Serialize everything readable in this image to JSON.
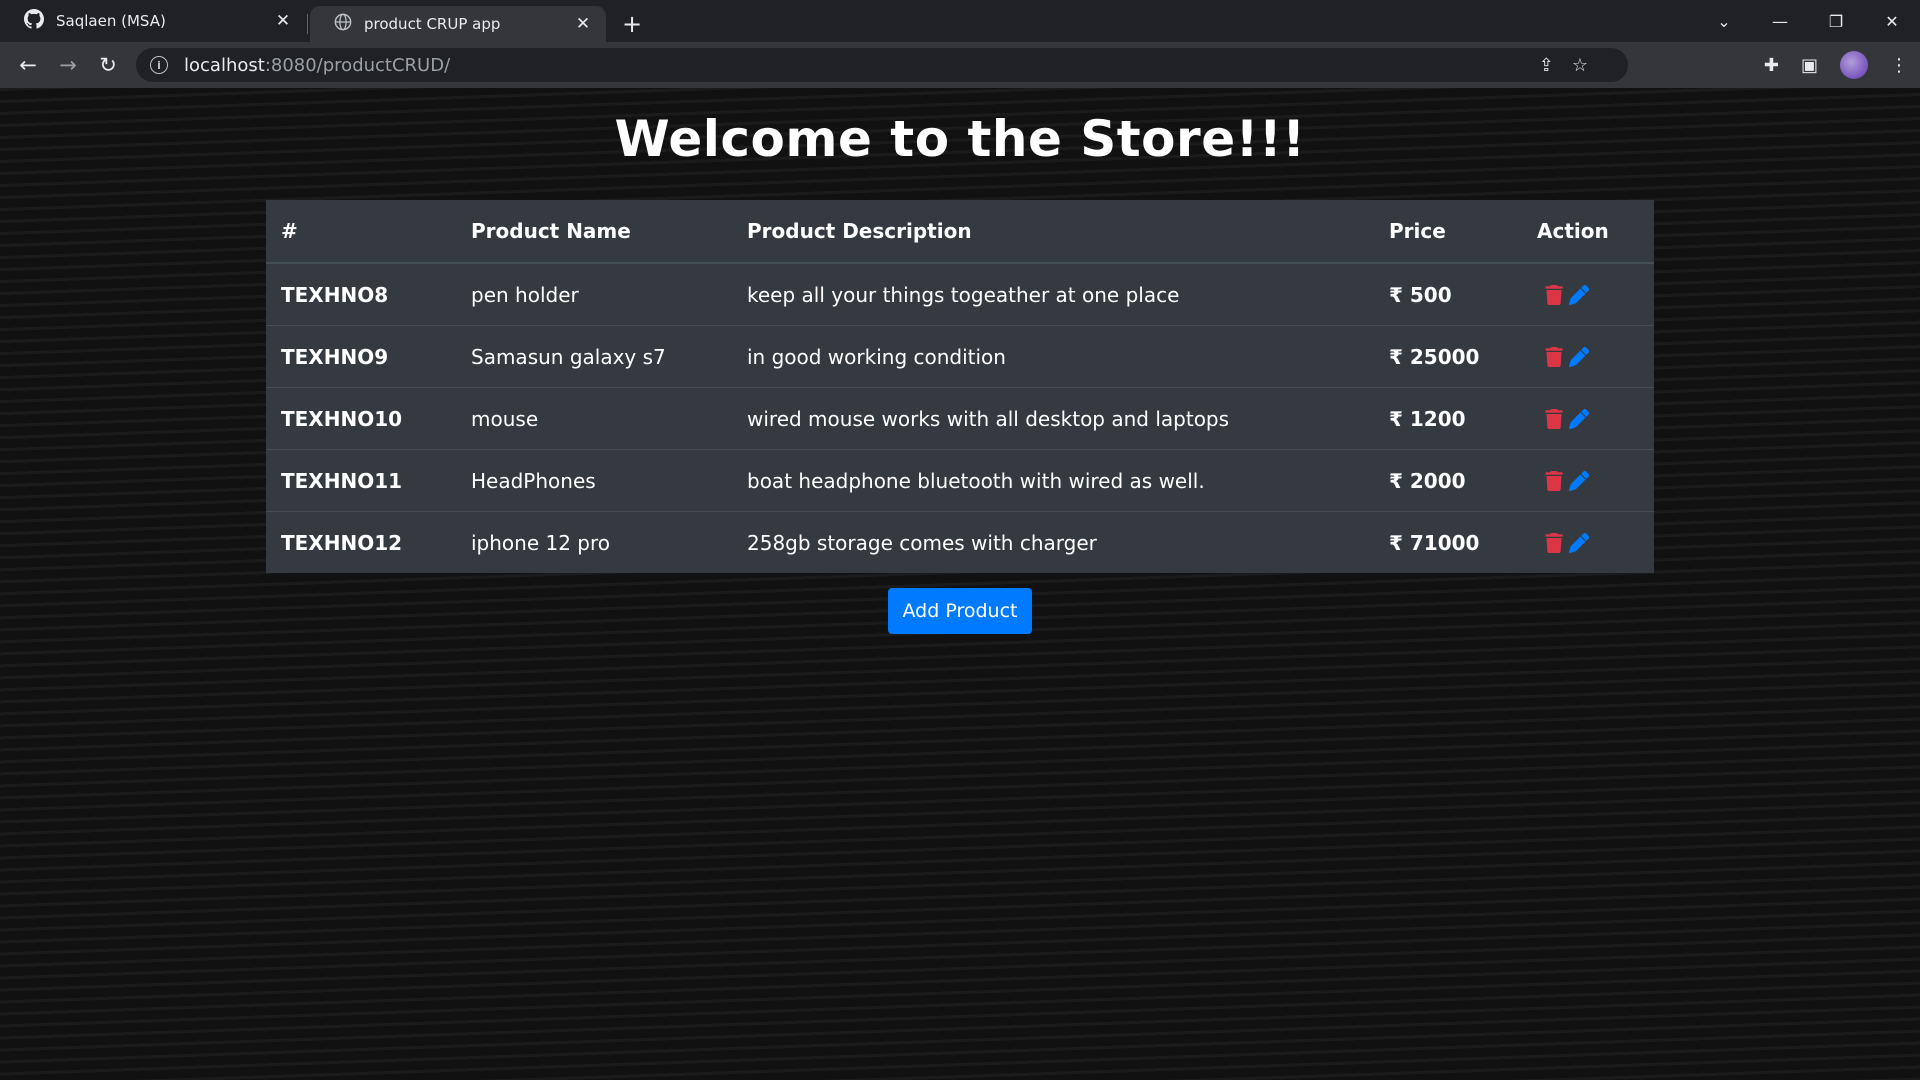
{
  "browser": {
    "tabs": [
      {
        "title": "Saqlaen (MSA)",
        "icon": "github-icon",
        "active": false
      },
      {
        "title": "product CRUP app",
        "icon": "globe-icon",
        "active": true
      }
    ],
    "url_host": "localhost",
    "url_rest": ":8080/productCRUD/"
  },
  "page": {
    "title": "Welcome to the Store!!!",
    "table": {
      "headers": [
        "#",
        "Product Name",
        "Product Description",
        "Price",
        "Action"
      ],
      "rows": [
        {
          "id": "TEXHNO8",
          "name": "pen holder",
          "description": "keep all your things togeather at one place",
          "price": "₹ 500"
        },
        {
          "id": "TEXHNO9",
          "name": "Samasun galaxy s7",
          "description": "in good working condition",
          "price": "₹ 25000"
        },
        {
          "id": "TEXHNO10",
          "name": "mouse",
          "description": "wired mouse works with all desktop and laptops",
          "price": "₹ 1200"
        },
        {
          "id": "TEXHNO11",
          "name": "HeadPhones",
          "description": "boat headphone bluetooth with wired as well.",
          "price": "₹ 2000"
        },
        {
          "id": "TEXHNO12",
          "name": "iphone 12 pro",
          "description": "258gb storage comes with charger",
          "price": "₹ 71000"
        }
      ]
    },
    "add_button_label": "Add Product"
  },
  "colors": {
    "table_bg": "#343a40",
    "delete_icon": "#dc3545",
    "edit_icon": "#007bff",
    "primary_button": "#007bff"
  }
}
